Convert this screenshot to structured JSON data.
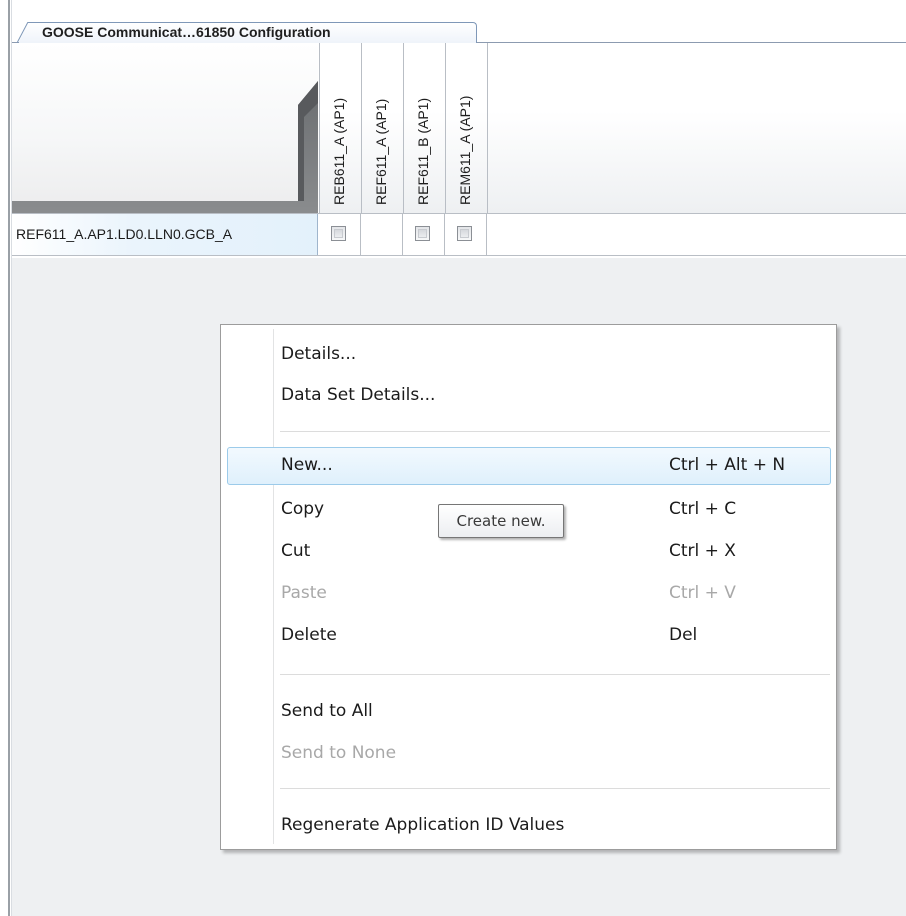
{
  "tab": {
    "label": "GOOSE Communicat…61850 Configuration"
  },
  "columns": [
    "REB611_A (AP1)",
    "REF611_A (AP1)",
    "REF611_B (AP1)",
    "REM611_A (AP1)"
  ],
  "row": {
    "label": "REF611_A.AP1.LD0.LLN0.GCB_A",
    "checkboxes": [
      true,
      false,
      true,
      true
    ]
  },
  "context_menu": {
    "items": [
      {
        "label": "Details...",
        "shortcut": "",
        "disabled": false
      },
      {
        "label": "Data Set Details...",
        "shortcut": "",
        "disabled": false
      },
      {
        "label": "New...",
        "shortcut": "Ctrl + Alt + N",
        "disabled": false,
        "highlighted": true
      },
      {
        "label": "Copy",
        "shortcut": "Ctrl + C",
        "disabled": false
      },
      {
        "label": "Cut",
        "shortcut": "Ctrl + X",
        "disabled": false
      },
      {
        "label": "Paste",
        "shortcut": "Ctrl + V",
        "disabled": true
      },
      {
        "label": "Delete",
        "shortcut": "Del",
        "disabled": false
      },
      {
        "label": "Send to All",
        "shortcut": "",
        "disabled": false
      },
      {
        "label": "Send to None",
        "shortcut": "",
        "disabled": true
      },
      {
        "label": "Regenerate Application ID Values",
        "shortcut": "",
        "disabled": false
      }
    ]
  },
  "tooltip": {
    "text": "Create new."
  }
}
